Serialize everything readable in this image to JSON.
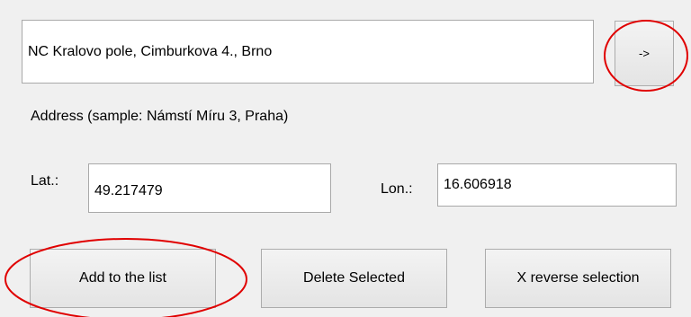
{
  "address": {
    "value": "NC Kralovo pole, Cimburkova 4., Brno",
    "hint": "Address (sample: Námstí Míru 3, Praha)",
    "go_button": "->"
  },
  "coords": {
    "lat_label": "Lat.:",
    "lat_value": "49.217479",
    "lon_label": "Lon.:",
    "lon_value": "16.606918"
  },
  "buttons": {
    "add": "Add to the list",
    "delete": "Delete Selected",
    "reverse": "X reverse selection"
  },
  "annotation": {
    "color": "#e00000"
  }
}
